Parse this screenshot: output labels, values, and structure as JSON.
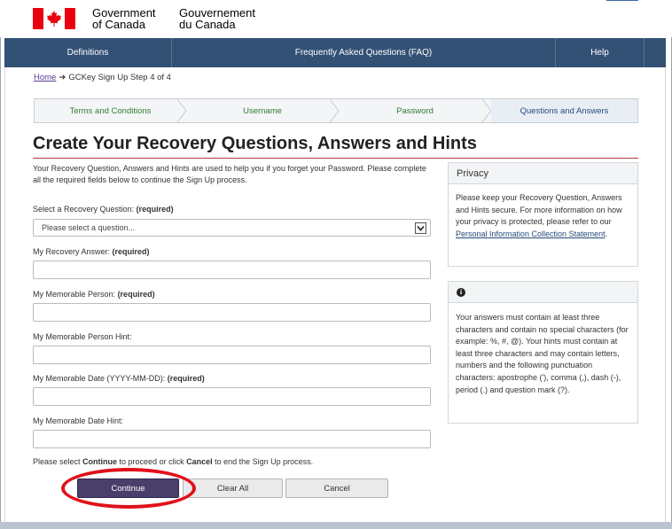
{
  "header": {
    "signature_en_line1": "Government",
    "signature_en_line2": "of Canada",
    "signature_fr_line1": "Gouvernement",
    "signature_fr_line2": "du Canada",
    "flag_icon": "canada-flag-icon"
  },
  "nav": {
    "items": [
      {
        "label": "Definitions"
      },
      {
        "label": "Frequently Asked Questions (FAQ)"
      },
      {
        "label": "Help"
      }
    ]
  },
  "breadcrumb": {
    "home": "Home",
    "current": "GCKey Sign Up Step 4 of 4"
  },
  "steps": [
    {
      "label": "Terms and Conditions",
      "state": "complete"
    },
    {
      "label": "Username",
      "state": "complete"
    },
    {
      "label": "Password",
      "state": "complete"
    },
    {
      "label": "Questions and Answers",
      "state": "current"
    }
  ],
  "colors": {
    "nav_bg": "#335075",
    "title_rule": "#af3c43",
    "continue_bg": "#4a3f6b",
    "highlight": "#e0101a",
    "step_complete": "#2e7d32"
  },
  "page": {
    "title": "Create Your Recovery Questions, Answers and Hints",
    "intro": "Your Recovery Question, Answers and Hints are used to help you if you forget your Password. Please complete all the required fields below to continue the Sign Up process."
  },
  "form": {
    "required_tag": "(required)",
    "question_label": "Select a Recovery Question:",
    "question_placeholder": "Please select a question...",
    "answer_label": "My Recovery Answer:",
    "person_label": "My Memorable Person:",
    "person_hint_label": "My Memorable Person Hint:",
    "date_label": "My Memorable Date (YYYY-MM-DD):",
    "date_hint_label": "My Memorable Date Hint:",
    "answer_value": "",
    "person_value": "",
    "person_hint_value": "",
    "date_value": "",
    "date_hint_value": ""
  },
  "instructions": {
    "part1": "Please select ",
    "continue_word": "Continue",
    "part2": " to proceed or click ",
    "cancel_word": "Cancel",
    "part3": " to end the Sign Up process."
  },
  "buttons": {
    "continue": "Continue",
    "clear_all": "Clear All",
    "cancel": "Cancel"
  },
  "privacy_panel": {
    "heading": "Privacy",
    "text": "Please keep your Recovery Question, Answers and Hints secure. For more information on how your privacy is protected, please refer to our ",
    "link": "Personal Information Collection Statement",
    "end": "."
  },
  "info_panel": {
    "icon": "info-icon",
    "icon_glyph": "i",
    "text": "Your answers must contain at least three characters and contain no special characters (for example: %, #, @). Your hints must contain at least three characters and may contain letters, numbers and the following punctuation characters: apostrophe ('), comma (,), dash (-), period (.) and question mark (?)."
  }
}
